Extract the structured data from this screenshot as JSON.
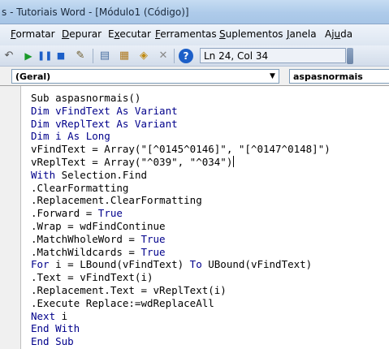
{
  "window": {
    "title": "s - Tutoriais Word - [Módulo1 (Código)]"
  },
  "menu": [
    {
      "label": "Formatar",
      "accel_index": 0
    },
    {
      "label": "Depurar",
      "accel_index": 0
    },
    {
      "label": "Executar",
      "accel_index": 1
    },
    {
      "label": "Ferramentas",
      "accel_index": 0
    },
    {
      "label": "Suplementos",
      "accel_index": 0
    },
    {
      "label": "Janela",
      "accel_index": 0
    },
    {
      "label": "Ajuda",
      "accel_index": 2
    }
  ],
  "toolbar": {
    "position": "Ln 24, Col 34",
    "icons": [
      "undo-icon",
      "run-icon",
      "break-icon",
      "reset-icon",
      "design-mode-icon",
      "project-explorer-icon",
      "properties-icon",
      "object-browser-icon",
      "toolbox-icon",
      "help-icon"
    ]
  },
  "dropdowns": {
    "object": "(Geral)",
    "procedure": "aspasnormais"
  },
  "code": {
    "lines": [
      [
        {
          "t": "Sub aspasnormais()",
          "k": false
        }
      ],
      [
        {
          "t": "Dim vFindText As Variant",
          "k": true
        }
      ],
      [
        {
          "t": "Dim vReplText As Variant",
          "k": true
        }
      ],
      [
        {
          "t": "Dim i As Long",
          "k": true
        }
      ],
      [
        {
          "t": "vFindText = Array(\"[^0145^0146]\", \"[^0147^0148]\")",
          "k": false
        }
      ],
      [
        {
          "t": "vReplText = Array(\"^039\", \"^034\")",
          "k": false
        }
      ],
      [
        {
          "t": "With",
          "k": true
        },
        {
          "t": " Selection.Find",
          "k": false
        }
      ],
      [
        {
          "t": ".ClearFormatting",
          "k": false
        }
      ],
      [
        {
          "t": ".Replacement.ClearFormatting",
          "k": false
        }
      ],
      [
        {
          "t": ".Forward = ",
          "k": false
        },
        {
          "t": "True",
          "k": true
        }
      ],
      [
        {
          "t": ".Wrap = wdFindContinue",
          "k": false
        }
      ],
      [
        {
          "t": ".MatchWholeWord = ",
          "k": false
        },
        {
          "t": "True",
          "k": true
        }
      ],
      [
        {
          "t": ".MatchWildcards = ",
          "k": false
        },
        {
          "t": "True",
          "k": true
        }
      ],
      [
        {
          "t": "For",
          "k": true
        },
        {
          "t": " i = LBound(vFindText) ",
          "k": false
        },
        {
          "t": "To",
          "k": true
        },
        {
          "t": " UBound(vFindText)",
          "k": false
        }
      ],
      [
        {
          "t": ".Text = vFindText(i)",
          "k": false
        }
      ],
      [
        {
          "t": ".Replacement.Text = vReplText(i)",
          "k": false
        }
      ],
      [
        {
          "t": ".Execute Replace:=wdReplaceAll",
          "k": false
        }
      ],
      [
        {
          "t": "Next",
          "k": true
        },
        {
          "t": " i",
          "k": false
        }
      ],
      [
        {
          "t": "End With",
          "k": true
        }
      ],
      [
        {
          "t": "End Sub",
          "k": true
        }
      ]
    ],
    "caret_line": 5
  },
  "colors": {
    "keyword": "#00008b",
    "text": "#000000",
    "run": "#1a9a2a",
    "help": "#1c5fc8"
  }
}
